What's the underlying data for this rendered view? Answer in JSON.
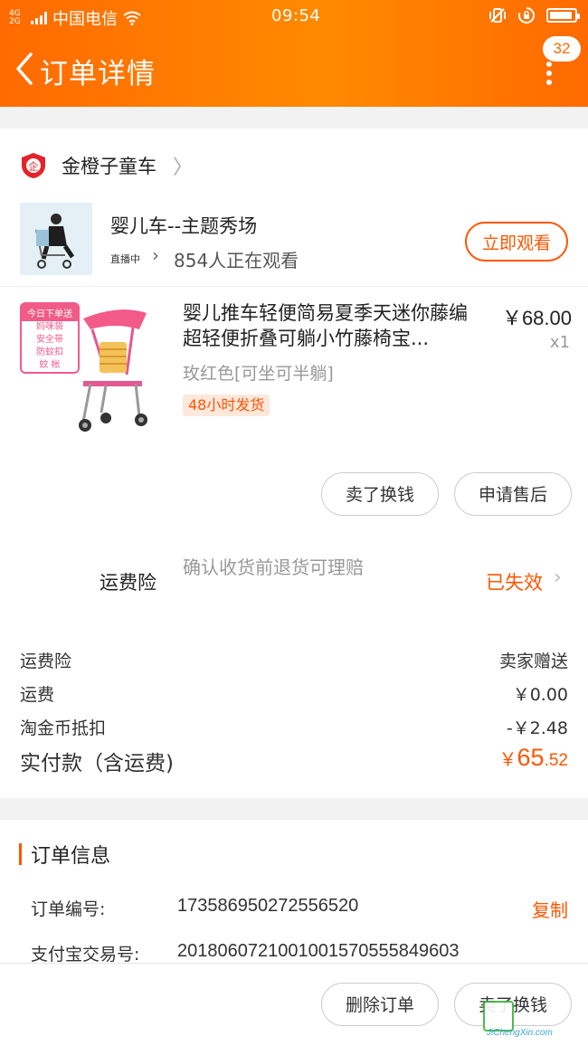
{
  "status_bar": {
    "network": "4G 2G",
    "carrier": "中国电信",
    "time": "09:54"
  },
  "header": {
    "title": "订单详情",
    "badge_count": "32"
  },
  "shop": {
    "name": "金橙子童车",
    "logo_text": "企"
  },
  "live": {
    "title": "婴儿车--主题秀场",
    "tag": "直播中",
    "viewers": "854人正在观看",
    "watch_button": "立即观看"
  },
  "product": {
    "title": "婴儿推车轻便简易夏季天迷你藤编超轻便折叠可躺小竹藤椅宝...",
    "price": "￥68.00",
    "quantity": "x1",
    "sku": "玫红色[可坐可半躺]",
    "ship_tag": "48小时发货",
    "image_promo": {
      "header": "今日下单送",
      "lines": [
        "妈咪袋",
        "安全带",
        "防蚊扣",
        "蚊 帐"
      ]
    }
  },
  "item_actions": {
    "resell": "卖了换钱",
    "after_sale": "申请售后"
  },
  "shipping_insurance": {
    "label": "运费险",
    "description": "确认收货前退货可理赔",
    "status": "已失效"
  },
  "fees": [
    {
      "label": "运费险",
      "value": "卖家赠送"
    },
    {
      "label": "运费",
      "value": "￥0.00"
    },
    {
      "label": "淘金币抵扣",
      "value": "-￥2.48"
    }
  ],
  "paid": {
    "label": "实付款（含运费)",
    "currency": "￥",
    "integer": "65",
    "decimal": ".52"
  },
  "order_info": {
    "title": "订单信息",
    "order_no_label": "订单编号:",
    "order_no": "173586950272556520",
    "copy": "复制",
    "alipay_label": "支付宝交易号:",
    "alipay_no": "2018060721001001570555849603"
  },
  "bottom": {
    "delete": "删除订单",
    "resell": "卖了换钱"
  },
  "watermark": {
    "url": "JiChengXin.com"
  },
  "colors": {
    "accent": "#ff5500",
    "header": "#ff7a00"
  }
}
